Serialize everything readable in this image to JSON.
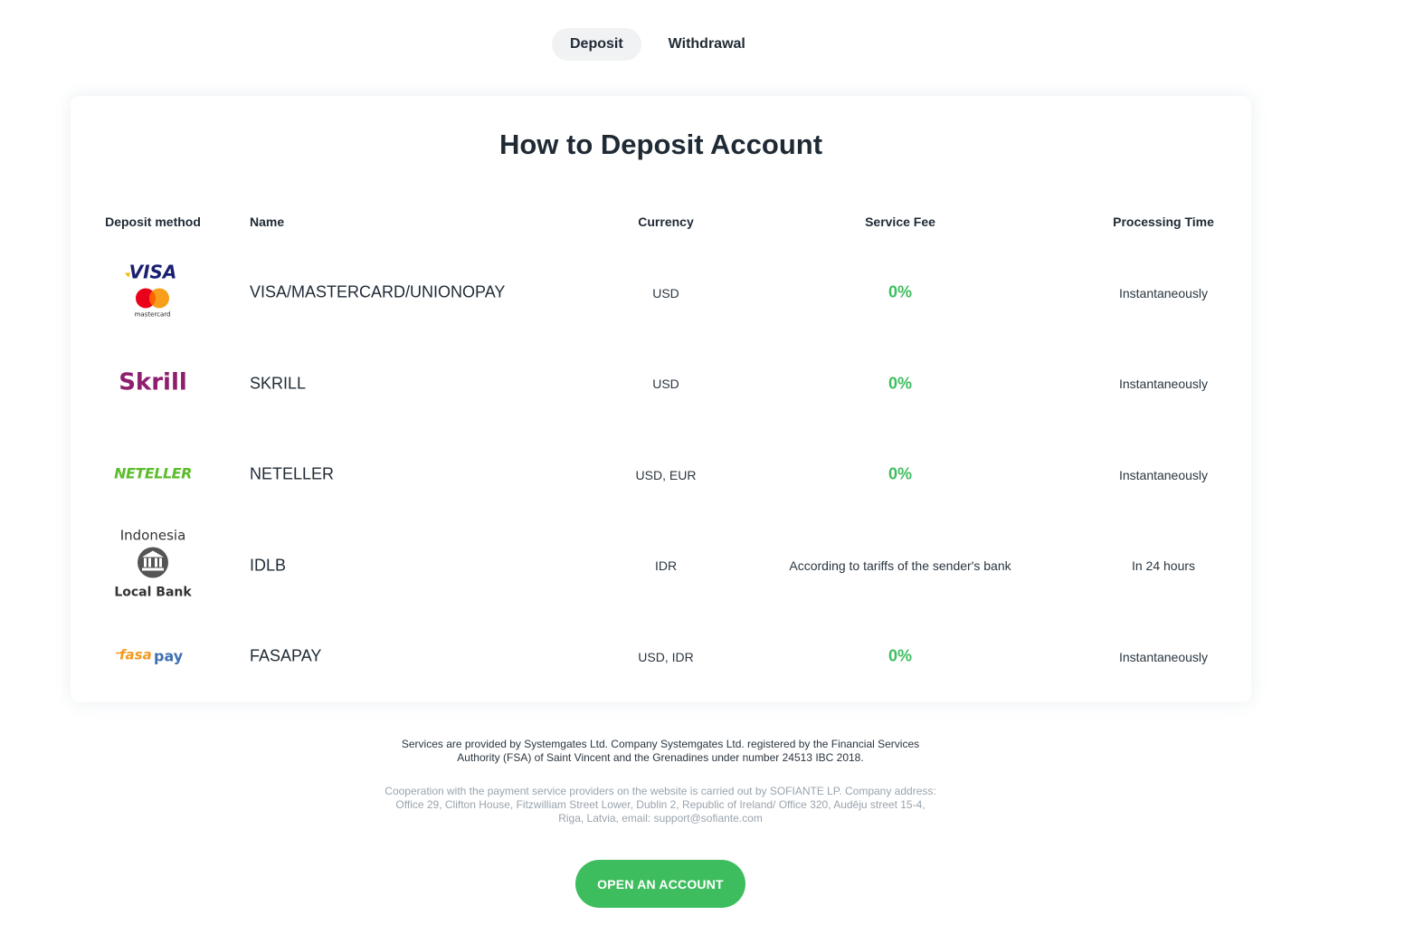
{
  "tabs": [
    {
      "label": "Deposit",
      "active": true
    },
    {
      "label": "Withdrawal",
      "active": false
    }
  ],
  "card": {
    "title": "How to Deposit Account",
    "headers": {
      "method": "Deposit method",
      "name": "Name",
      "currency": "Currency",
      "fee": "Service Fee",
      "time": "Processing Time"
    },
    "rows": [
      {
        "logo": "visa-mastercard-logo",
        "logo_text": [
          "VISA",
          "mastercard"
        ],
        "name": "VISA/MASTERCARD/UNIONOPAY",
        "currency": "USD",
        "fee": "0%",
        "time": "Instantaneously"
      },
      {
        "logo": "skrill-logo",
        "logo_text": [
          "Skrill"
        ],
        "name": "SKRILL",
        "currency": "USD",
        "fee": "0%",
        "time": "Instantaneously"
      },
      {
        "logo": "neteller-logo",
        "logo_text": [
          "NETELLER"
        ],
        "name": "NETELLER",
        "currency": "USD, EUR",
        "fee": "0%",
        "time": "Instantaneously"
      },
      {
        "logo": "local-bank-logo",
        "logo_text": [
          "Indonesia",
          "Local Bank"
        ],
        "name": "IDLB",
        "currency": "IDR",
        "fee": "According to tariffs of the sender's bank",
        "time": "In 24 hours"
      },
      {
        "logo": "fasapay-logo",
        "logo_text": [
          "fasa",
          "pay"
        ],
        "name": "FASAPAY",
        "currency": "USD, IDR",
        "fee": "0%",
        "time": "Instantaneously"
      }
    ]
  },
  "footer": {
    "line1": "Services are provided by Systemgates Ltd. Company Systemgates Ltd. registered by the Financial Services Authority (FSA) of Saint Vincent and the Grenadines under number 24513 IBC 2018.",
    "line2": "Cooperation with the payment service providers on the website is carried out by SOFIANTE LP. Company address: Office 29, Clifton House, Fitzwilliam Street Lower, Dublin 2, Republic of Ireland/ Office 320, Audēju street 15-4, Riga, Latvia, email: support@sofiante.com"
  },
  "cta": {
    "label": "OPEN AN ACCOUNT"
  },
  "colors": {
    "accent": "#3ebd5f",
    "skrill": "#8e1f6e",
    "neteller": "#5bbd2b",
    "visa": "#1a1f71",
    "mc_red": "#eb001b",
    "mc_orange": "#f79e1b",
    "fasapay_orange": "#f29a1f",
    "fasapay_blue": "#3d6fb4"
  }
}
